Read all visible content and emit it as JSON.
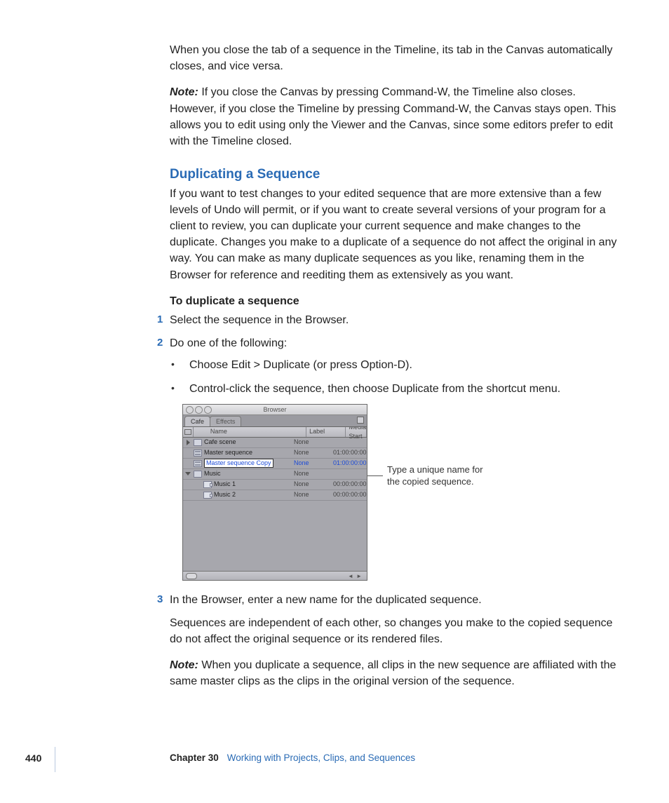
{
  "paragraphs": {
    "intro": "When you close the tab of a sequence in the Timeline, its tab in the Canvas automatically closes, and vice versa.",
    "note1_label": "Note:",
    "note1": "  If you close the Canvas by pressing Command-W, the Timeline also closes. However, if you close the Timeline by pressing Command-W, the Canvas stays open. This allows you to edit using only the Viewer and the Canvas, since some editors prefer to edit with the Timeline closed."
  },
  "heading": "Duplicating a Sequence",
  "dup_intro": "If you want to test changes to your edited sequence that are more extensive than a few levels of Undo will permit, or if you want to create several versions of your program for a client to review, you can duplicate your current sequence and make changes to the duplicate. Changes you make to a duplicate of a sequence do not affect the original in any way. You can make as many duplicate sequences as you like, renaming them in the Browser for reference and reediting them as extensively as you want.",
  "task_title": "To duplicate a sequence",
  "steps": {
    "s1": "Select the sequence in the Browser.",
    "s2": "Do one of the following:",
    "s3": "In the Browser, enter a new name for the duplicated sequence."
  },
  "bullets": {
    "b1": "Choose Edit > Duplicate (or press Option-D).",
    "b2": "Control-click the sequence, then choose Duplicate from the shortcut menu."
  },
  "browser": {
    "title": "Browser",
    "tabs": {
      "t1": "Cafe",
      "t2": "Effects"
    },
    "cols": {
      "name": "Name",
      "label": "Label",
      "media": "Media Start"
    },
    "rows": [
      {
        "name": "Cafe scene",
        "label": "None",
        "media": ""
      },
      {
        "name": "Master sequence",
        "label": "None",
        "media": "01:00:00:00"
      },
      {
        "name": "Master sequence Copy",
        "label": "None",
        "media": "01:00:00:00"
      },
      {
        "name": "Music",
        "label": "None",
        "media": ""
      },
      {
        "name": "Music 1",
        "label": "None",
        "media": "00:00:00:00"
      },
      {
        "name": "Music 2",
        "label": "None",
        "media": "00:00:00:00"
      }
    ]
  },
  "callout": "Type a unique name for the copied sequence.",
  "after": {
    "p1": "Sequences are independent of each other, so changes you make to the copied sequence do not affect the original sequence or its rendered files.",
    "note2_label": "Note:",
    "note2": "  When you duplicate a sequence, all clips in the new sequence are affiliated with the same master clips as the clips in the original version of the sequence."
  },
  "footer": {
    "page": "440",
    "chapter_bold": "Chapter 30",
    "chapter_title": "Working with Projects, Clips, and Sequences"
  }
}
